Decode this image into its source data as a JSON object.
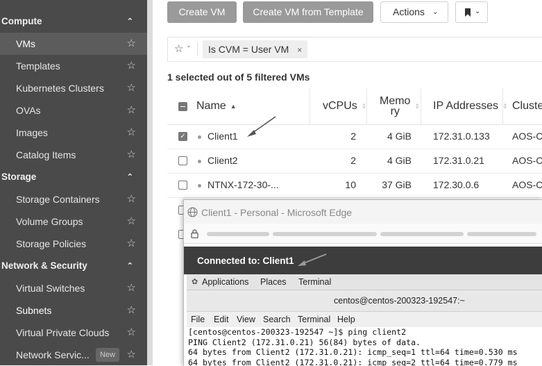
{
  "sidebar": {
    "sections": [
      {
        "label": "Compute",
        "items": [
          {
            "label": "VMs",
            "active": true
          },
          {
            "label": "Templates"
          },
          {
            "label": "Kubernetes Clusters"
          },
          {
            "label": "OVAs"
          },
          {
            "label": "Images"
          },
          {
            "label": "Catalog Items"
          }
        ]
      },
      {
        "label": "Storage",
        "items": [
          {
            "label": "Storage Containers"
          },
          {
            "label": "Volume Groups"
          },
          {
            "label": "Storage Policies"
          }
        ]
      },
      {
        "label": "Network & Security",
        "items": [
          {
            "label": "Virtual Switches"
          },
          {
            "label": "Subnets"
          },
          {
            "label": "Virtual Private Clouds"
          },
          {
            "label": "Network Servic...",
            "badge": "New"
          }
        ]
      }
    ]
  },
  "toolbar": {
    "create_vm": "Create VM",
    "create_from_template": "Create VM from Template",
    "actions": "Actions"
  },
  "filter": {
    "chip": "Is CVM = User VM"
  },
  "selection_summary": "1 selected out of 5 filtered VMs",
  "table": {
    "columns": [
      "Name",
      "vCPUs",
      "Memo\nry",
      "IP Addresses",
      "Cluster"
    ],
    "rows": [
      {
        "name": "Client1",
        "vcpus": "2",
        "memory": "4 GiB",
        "ip": "172.31.0.133",
        "cluster": "AOS-C",
        "checked": true
      },
      {
        "name": "Client2",
        "vcpus": "2",
        "memory": "4 GiB",
        "ip": "172.31.0.21",
        "cluster": "AOS-C",
        "checked": false
      },
      {
        "name": "NTNX-172-30-...",
        "vcpus": "10",
        "memory": "37 GiB",
        "ip": "172.30.0.6",
        "cluster": "AOS-C",
        "checked": false
      }
    ]
  },
  "edge_window": {
    "title": "Client1 - Personal - Microsoft Edge",
    "connected": "Connected to: Client1",
    "gnome_menu": [
      "Applications",
      "Places",
      "Terminal"
    ],
    "terminal_title": "centos@centos-200323-192547:~",
    "terminal_menu": [
      "File",
      "Edit",
      "View",
      "Search",
      "Terminal",
      "Help"
    ],
    "terminal_lines": [
      "[centos@centos-200323-192547 ~]$ ping client2",
      "PING Client2 (172.31.0.21) 56(84) bytes of data.",
      "64 bytes from Client2 (172.31.0.21): icmp_seq=1 ttl=64 time=0.530 ms",
      "64 bytes from Client2 (172.31.0.21): icmp_seq=2 ttl=64 time=0.779 ms"
    ]
  },
  "colors": {
    "sidebar_bg": "#4a4a4a",
    "button_grey": "#9a9a9a",
    "connect_bar": "#3d3d3d"
  }
}
